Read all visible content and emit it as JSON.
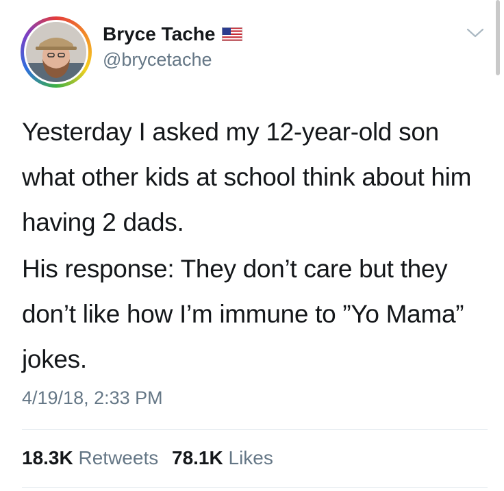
{
  "user": {
    "display_name": "Bryce Tache",
    "handle": "@brycetache",
    "flag_icon": "us-flag-icon",
    "avatar_ring_colors": [
      "#e33b3b",
      "#f28c28",
      "#f5d020",
      "#3cb043",
      "#2f6fdd",
      "#7b3fc4"
    ]
  },
  "tweet": {
    "paragraphs": [
      "Yesterday I asked my 12-year-old son what other kids at school think about him having 2 dads.",
      "His response: They don’t care but they don’t like how I’m immune to ”Yo Mama” jokes."
    ],
    "timestamp": "4/19/18, 2:33 PM"
  },
  "stats": {
    "retweets_count": "18.3K",
    "retweets_label": "Retweets",
    "likes_count": "78.1K",
    "likes_label": "Likes"
  },
  "colors": {
    "text_primary": "#14171a",
    "text_secondary": "#657786",
    "divider": "#e1e8ed"
  }
}
